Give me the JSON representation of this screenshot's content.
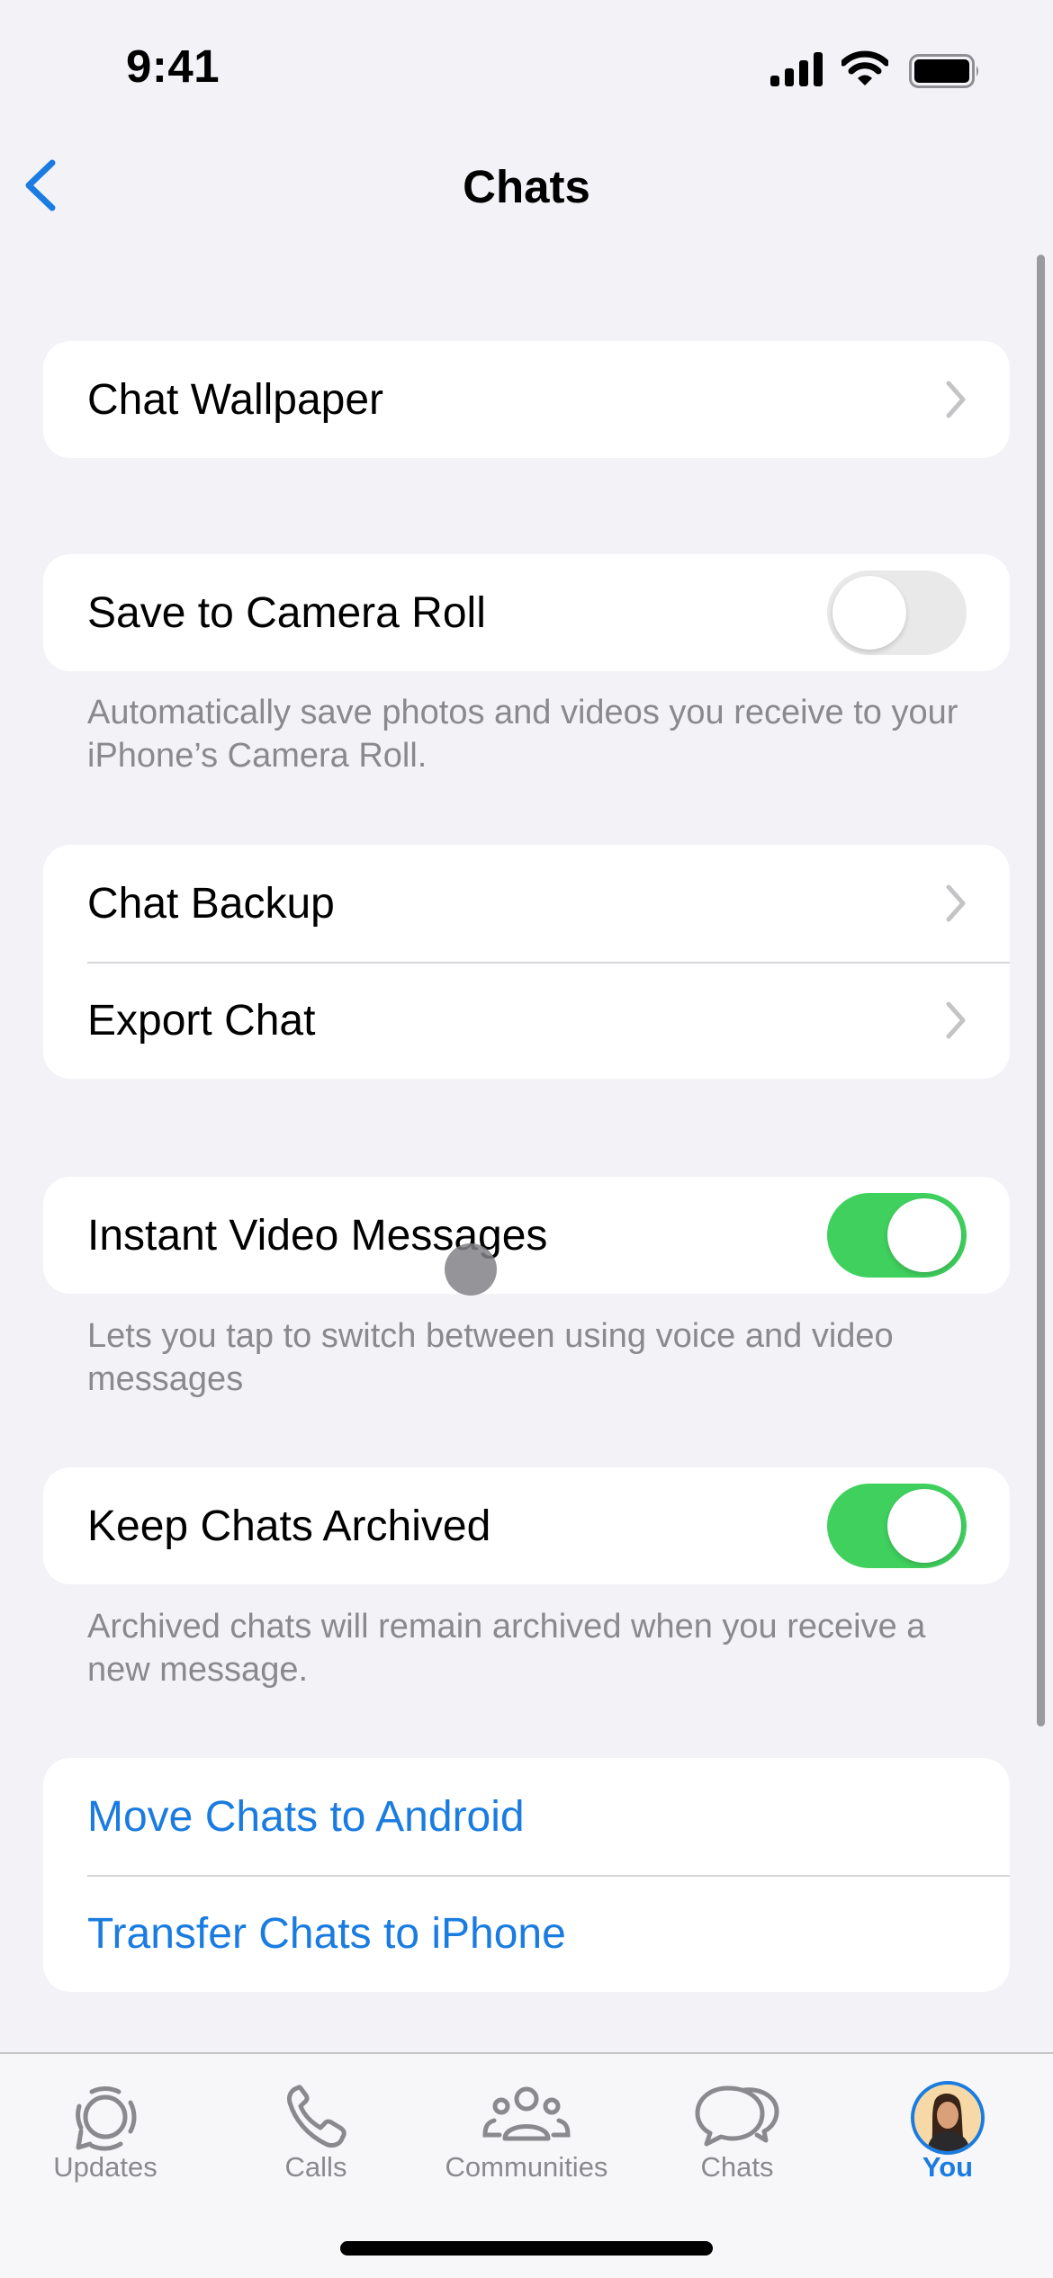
{
  "status_bar": {
    "time": "9:41"
  },
  "nav": {
    "title": "Chats",
    "back_icon": "chevron-left-icon"
  },
  "sections": {
    "wallpaper": {
      "label": "Chat Wallpaper"
    },
    "camera_roll": {
      "label": "Save to Camera Roll",
      "enabled": false,
      "footer": "Automatically save photos and videos you receive to your iPhone’s Camera Roll."
    },
    "backup": {
      "label": "Chat Backup"
    },
    "export": {
      "label": "Export Chat"
    },
    "instant_video": {
      "label": "Instant Video Messages",
      "enabled": true,
      "footer": "Lets you tap to switch between using voice and video messages"
    },
    "keep_archived": {
      "label": "Keep Chats Archived",
      "enabled": true,
      "footer": "Archived chats will remain archived when you receive a new message."
    },
    "move_android": {
      "label": "Move Chats to Android"
    },
    "transfer_iphone": {
      "label": "Transfer Chats to iPhone"
    }
  },
  "tabs": [
    {
      "label": "Updates",
      "icon": "updates-icon",
      "active": false
    },
    {
      "label": "Calls",
      "icon": "phone-icon",
      "active": false
    },
    {
      "label": "Communities",
      "icon": "communities-icon",
      "active": false
    },
    {
      "label": "Chats",
      "icon": "chat-bubbles-icon",
      "active": false
    },
    {
      "label": "You",
      "icon": "avatar",
      "active": true
    }
  ],
  "colors": {
    "accent": "#1a7ce0",
    "toggle_on": "#3fd05e",
    "toggle_off": "#e9e9ea",
    "background": "#f2f2f7"
  }
}
